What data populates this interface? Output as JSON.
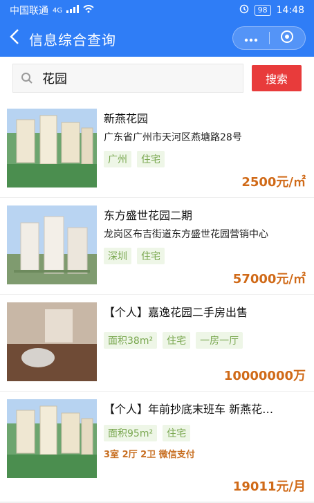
{
  "status": {
    "carrier": "中国联通",
    "network": "4G",
    "battery": "98",
    "time": "14:48"
  },
  "nav": {
    "title": "信息综合查询",
    "back_icon": "chevron-left-icon",
    "more_icon": "more-dots-icon",
    "close_icon": "target-icon"
  },
  "search": {
    "value": "花园",
    "placeholder": "",
    "button_label": "搜索"
  },
  "list": [
    {
      "name": "新燕花园",
      "address": "广东省广州市天河区燕塘路28号",
      "tags": [
        "广州",
        "住宅"
      ],
      "price": "2500元/㎡"
    },
    {
      "name": "东方盛世花园二期",
      "address": "龙岗区布吉街道东方盛世花园营销中心",
      "tags": [
        "深圳",
        "住宅"
      ],
      "price": "57000元/㎡"
    },
    {
      "name": "【个人】嘉逸花园二手房出售",
      "tags": [
        "面积38m²",
        "住宅",
        "一房一厅"
      ],
      "price": "10000000万"
    },
    {
      "name": "【个人】年前抄底末班车 新燕花…",
      "tags": [
        "面积95m²",
        "住宅"
      ],
      "extra": "3室 2厅 2卫 微信支付",
      "price": "19011元/月"
    }
  ],
  "colors": {
    "accent": "#2f7df6",
    "search_button": "#e83b3b",
    "tag_bg": "#eef6e7",
    "tag_text": "#79a74f",
    "price": "#d06a18"
  }
}
